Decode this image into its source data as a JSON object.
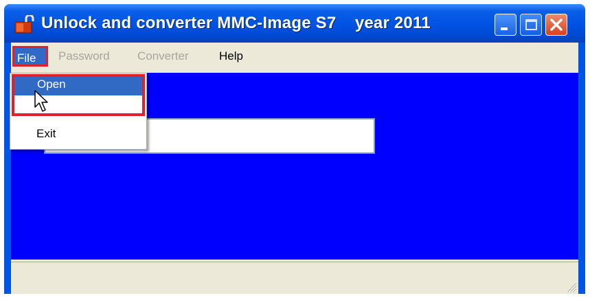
{
  "window": {
    "title": "Unlock and converter MMC-Image S7    year 2011",
    "title_bar_color": "#0054e3",
    "client_color": "#0000ff",
    "icon": "app-lock-icon",
    "buttons": [
      "minimize-icon",
      "maximize-icon",
      "close-icon"
    ]
  },
  "menubar": {
    "items": [
      {
        "label": "File",
        "state": "open"
      },
      {
        "label": "Password",
        "state": "disabled"
      },
      {
        "label": "Converter",
        "state": "disabled"
      },
      {
        "label": "Help",
        "state": "enabled"
      }
    ]
  },
  "file_menu": {
    "items": [
      {
        "label": "Open",
        "highlighted": true
      },
      {
        "label": ""
      },
      {
        "label": "Exit"
      }
    ]
  },
  "path_field": {
    "value": ""
  },
  "status_bar": {
    "text": ""
  },
  "annotation_color": "#e0202c"
}
